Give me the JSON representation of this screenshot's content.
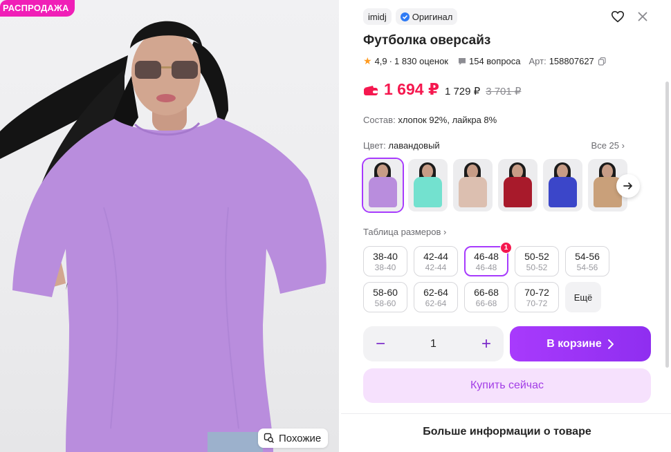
{
  "photo": {
    "sale_badge": "РАСПРОДАЖА",
    "similar_label": "Похожие"
  },
  "product": {
    "brand_tag": "imidj",
    "original_tag": "Оригинал",
    "title": "Футболка оверсайз",
    "rating": "4,9",
    "reviews": "1 830 оценок",
    "questions": "154 вопроса",
    "article_label": "Арт:",
    "article": "158807627",
    "price_main": "1 694 ₽",
    "price_card": "1 729 ₽",
    "price_old": "3 701 ₽",
    "composition_label": "Состав:",
    "composition": "хлопок 92%, лайкра 8%",
    "color_label": "Цвет:",
    "color_value": "лавандовый",
    "all_colors": "Все 25",
    "size_table_link": "Таблица размеров",
    "more_sizes": "Ещё",
    "selected_size_badge": "1"
  },
  "color_thumbs": [
    {
      "name": "lavender",
      "shirt": "#b98ddd",
      "bg": "#eeeef0"
    },
    {
      "name": "mint",
      "shirt": "#73e1cf",
      "bg": "#ededef"
    },
    {
      "name": "beige",
      "shirt": "#dcbfb0",
      "bg": "#ececee"
    },
    {
      "name": "burgundy",
      "shirt": "#a81a2b",
      "bg": "#ececee"
    },
    {
      "name": "blue",
      "shirt": "#3b46c9",
      "bg": "#ededef"
    },
    {
      "name": "print",
      "shirt": "#c9a07a",
      "bg": "#ededef"
    }
  ],
  "sizes": [
    {
      "ru": "38-40",
      "alt": "38-40",
      "selected": false
    },
    {
      "ru": "42-44",
      "alt": "42-44",
      "selected": false
    },
    {
      "ru": "46-48",
      "alt": "46-48",
      "selected": true
    },
    {
      "ru": "50-52",
      "alt": "50-52",
      "selected": false
    },
    {
      "ru": "54-56",
      "alt": "54-56",
      "selected": false
    },
    {
      "ru": "58-60",
      "alt": "58-60",
      "selected": false
    },
    {
      "ru": "62-64",
      "alt": "62-64",
      "selected": false
    },
    {
      "ru": "66-68",
      "alt": "66-68",
      "selected": false
    },
    {
      "ru": "70-72",
      "alt": "70-72",
      "selected": false
    }
  ],
  "cart": {
    "quantity": "1",
    "minus": "−",
    "plus": "+",
    "in_cart_label": "В корзине",
    "buy_now_label": "Купить сейчас"
  },
  "footer": {
    "more_info": "Больше информации о товаре"
  },
  "colors": {
    "accent": "#a73afd",
    "price": "#f5184f",
    "sale": "#f01fb7",
    "shirt": "#b98ddd"
  },
  "icons": {
    "heart": "heart-icon",
    "close": "close-icon",
    "star": "star-icon",
    "question": "question-icon",
    "copy": "copy-icon",
    "wallet": "wallet-icon",
    "similar": "similar-search-icon",
    "arrow": "arrow-right-icon"
  }
}
